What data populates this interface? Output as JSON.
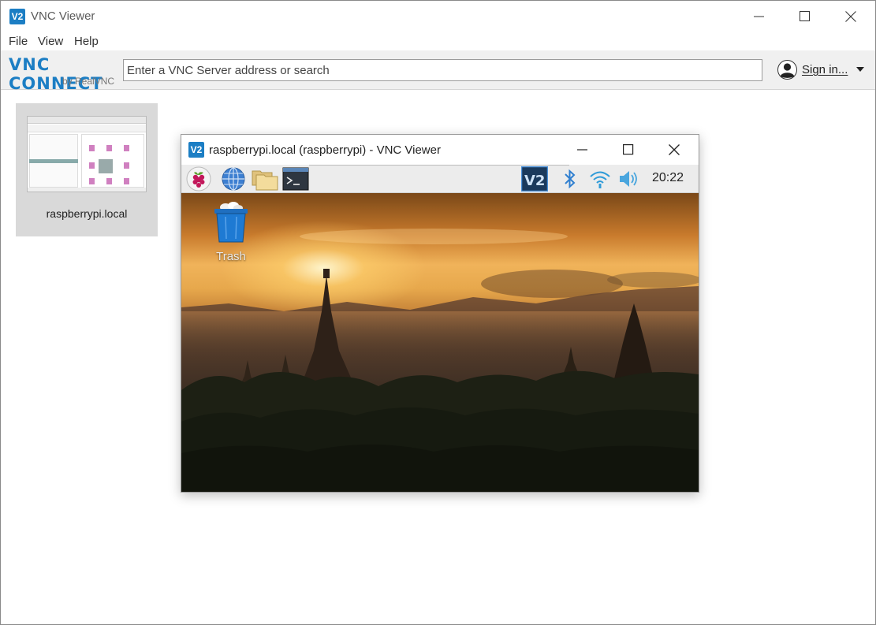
{
  "window": {
    "title": "VNC Viewer",
    "logo_text": "V2"
  },
  "menu": {
    "file": "File",
    "view": "View",
    "help": "Help"
  },
  "toolbar": {
    "brand_main": "VNC CONNECT",
    "brand_sub": "by RealVNC",
    "search_placeholder": "Enter a VNC Server address or search",
    "signin_label": "Sign in..."
  },
  "tile": {
    "label": "raspberrypi.local"
  },
  "remote_window": {
    "title": "raspberrypi.local (raspberrypi) - VNC Viewer",
    "logo_text": "V2",
    "clock": "20:22",
    "desktop_icon_label": "Trash"
  },
  "colors": {
    "accent": "#1c7ec4",
    "toolbar_bg": "#f0f0f0",
    "tile_bg": "#d9d9d9"
  },
  "icons": {
    "minimize": "minimize-icon",
    "maximize": "maximize-icon",
    "close": "close-icon",
    "user": "user-icon",
    "dropdown": "chevron-down-icon"
  }
}
